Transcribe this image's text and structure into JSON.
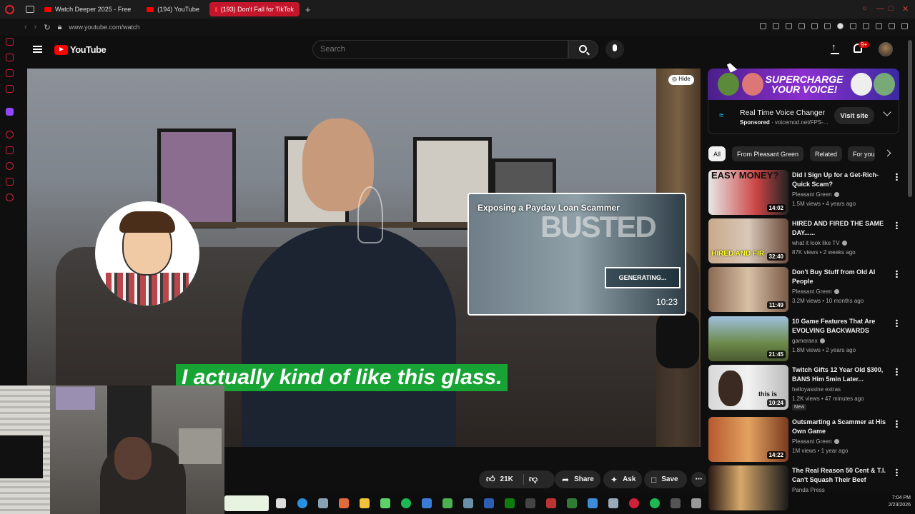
{
  "browser": {
    "tabs": [
      {
        "label": "Watch Deeper 2025 - Free",
        "active": false
      },
      {
        "label": "(194) YouTube",
        "active": false
      },
      {
        "label": "(193) Don't Fall for TikTok",
        "active": true
      }
    ],
    "new_tab": "+",
    "url": "www.youtube.com/watch"
  },
  "header": {
    "logo_text": "YouTube",
    "search_placeholder": "Search",
    "notification_count": "9+"
  },
  "player": {
    "hide_label": "Hide",
    "caption": "I actually kind of like this glass.",
    "endcard": {
      "title": "Exposing a Payday Loan Scammer",
      "overlay_word": "BUSTED",
      "overlay_status": "GENERATING...",
      "duration": "10:23"
    }
  },
  "actions": {
    "likes": "21K",
    "share": "Share",
    "ask": "Ask",
    "save": "Save"
  },
  "ad": {
    "banner": "SUPERCHARGE YOUR VOICE!",
    "title": "Real Time Voice Changer",
    "sponsored": "Sponsored",
    "domain": "voicemod.net/FPS-...",
    "visit": "Visit site"
  },
  "chips": [
    "All",
    "From Pleasant Green",
    "Related",
    "For you"
  ],
  "recommendations": [
    {
      "title": "Did I Sign Up for a Get-Rich-Quick Scam?",
      "channel": "Pleasant Green",
      "verified": true,
      "meta": "1.5M views • 4 years ago",
      "duration": "14:02",
      "thumb_text": "EASY MONEY?",
      "new": ""
    },
    {
      "title": "HIRED AND FIRED THE SAME DAY......",
      "channel": "what it look like TV",
      "verified": true,
      "meta": "87K views • 2 weeks ago",
      "duration": "32:40",
      "thumb_text": "HIRED AND FIR",
      "new": ""
    },
    {
      "title": "Don't Buy Stuff from Old AI People",
      "channel": "Pleasant Green",
      "verified": true,
      "meta": "3.2M views • 10 months ago",
      "duration": "11:49",
      "thumb_text": "",
      "new": ""
    },
    {
      "title": "10 Game Features That Are EVOLVING BACKWARDS",
      "channel": "gameranx",
      "verified": true,
      "meta": "1.8M views • 2 years ago",
      "duration": "21:45",
      "thumb_text": "",
      "new": ""
    },
    {
      "title": "Twitch Gifts 12 Year Old $300, BANS Him 5min Later...",
      "channel": "helloyassine extras",
      "verified": false,
      "meta": "1.2K views • 47 minutes ago",
      "duration": "10:24",
      "thumb_text": "this is",
      "new": "New"
    },
    {
      "title": "Outsmarting a Scammer at His Own Game",
      "channel": "Pleasant Green",
      "verified": true,
      "meta": "1M views • 1 year ago",
      "duration": "14:22",
      "thumb_text": "",
      "new": ""
    },
    {
      "title": "The Real Reason 50 Cent & T.I. Can't Squash Their Beef",
      "channel": "Panda Press",
      "verified": false,
      "meta": "",
      "duration": "",
      "thumb_text": "",
      "new": ""
    }
  ],
  "taskbar": {
    "time": "7:04 PM",
    "date": "2/23/2026"
  },
  "colors": {
    "yt_red": "#ff0000",
    "caption_green": "#18a335",
    "opera_red": "#d0213a"
  }
}
